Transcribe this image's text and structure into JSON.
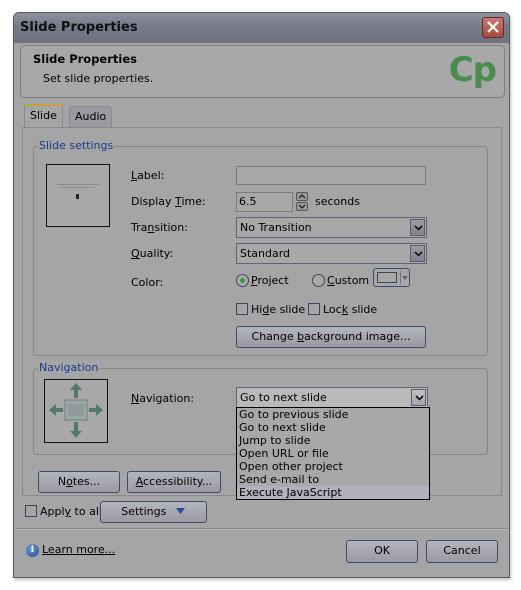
{
  "window": {
    "title": "Slide Properties",
    "close_icon": "close-icon"
  },
  "header": {
    "title": "Slide Properties",
    "subtitle": "Set slide properties.",
    "logo_text": "Cp",
    "logo_color": "#4a8c50"
  },
  "tabs": [
    {
      "label": "Slide",
      "active": true
    },
    {
      "label": "Audio",
      "active": false
    }
  ],
  "slide_settings": {
    "group_label": "Slide settings",
    "label_field": {
      "label_prefix": "",
      "label_mnemonic": "L",
      "label_rest": "abel:",
      "value": ""
    },
    "display_time": {
      "label_prefix": "Display ",
      "label_mnemonic": "T",
      "label_rest": "ime:",
      "value": "6.5",
      "unit": "seconds"
    },
    "transition": {
      "label_prefix": "Tra",
      "label_mnemonic": "n",
      "label_rest": "sition:",
      "value": "No Transition"
    },
    "quality": {
      "label_prefix": "",
      "label_mnemonic": "Q",
      "label_rest": "uality:",
      "value": "Standard"
    },
    "color": {
      "label": "Color:",
      "project": {
        "prefix": "",
        "mnemonic": "P",
        "rest": "roject",
        "selected": true
      },
      "custom": {
        "prefix": "",
        "mnemonic": "C",
        "rest": "ustom",
        "selected": false
      }
    },
    "hide_slide": {
      "prefix": "Hi",
      "mnemonic": "d",
      "rest": "e slide",
      "checked": false
    },
    "lock_slide": {
      "prefix": "Loc",
      "mnemonic": "k",
      "rest": " slide",
      "checked": false
    },
    "change_bg": {
      "prefix": "Change ",
      "mnemonic": "b",
      "rest": "ackground image..."
    }
  },
  "navigation": {
    "group_label": "Navigation",
    "label_mnemonic": "N",
    "label_rest": "avigation:",
    "value": "Go to next slide",
    "options": [
      "Go to previous slide",
      "Go to next slide",
      "Jump to slide",
      "Open URL or file",
      "Open other project",
      "Send e-mail to",
      "Execute JavaScript"
    ],
    "highlighted_option": "Execute JavaScript"
  },
  "buttons": {
    "notes": {
      "prefix": "N",
      "mnemonic": "o",
      "rest": "tes..."
    },
    "accessibility": {
      "prefix": "",
      "mnemonic": "A",
      "rest": "ccessibility..."
    },
    "settings": "Settings",
    "ok": "OK",
    "cancel": "Cancel"
  },
  "apply_to_all": {
    "prefix": "Appl",
    "mnemonic": "y",
    "rest": " to all",
    "checked": false
  },
  "footer": {
    "learn_more": "Learn more..."
  }
}
